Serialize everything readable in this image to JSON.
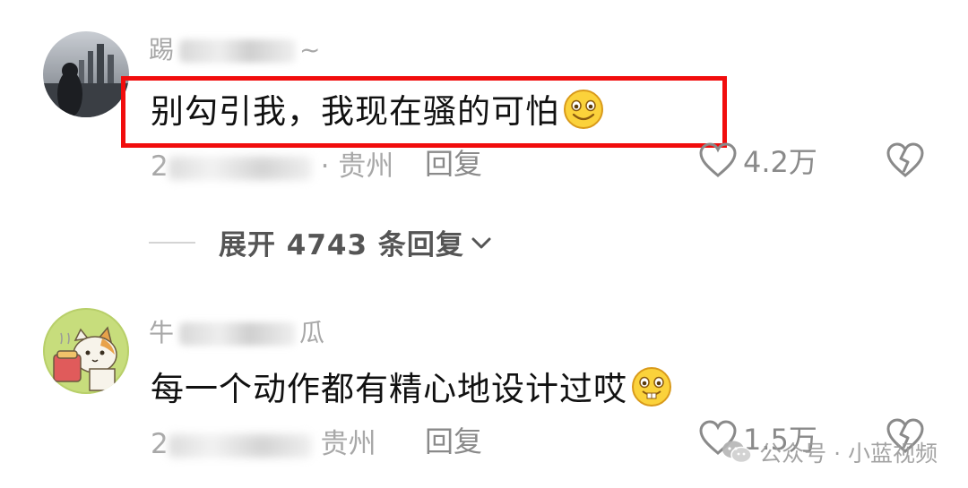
{
  "comments": [
    {
      "username_prefix": "踢",
      "username_suffix": "~",
      "text": "别勾引我，我现在骚的可怕",
      "meta_prefix": "2",
      "location": "· 贵州",
      "reply_label": "回复",
      "like_count": "4.2万",
      "emoji": "smiling-face-emoji",
      "highlighted": true
    },
    {
      "username_prefix": "牛",
      "username_suffix": "瓜",
      "text": "每一个动作都有精心地设计过哎",
      "meta_prefix": "2",
      "location": "贵州",
      "reply_label": "回复",
      "like_count": "1.5万",
      "emoji": "buck-tooth-face-emoji",
      "highlighted": false
    }
  ],
  "expand_replies": {
    "label": "展开 4743 条回复"
  },
  "watermark": {
    "text": "公众号 · 小蓝视频"
  },
  "colors": {
    "highlight_border": "#f10d0d",
    "secondary_text": "#a8a8a8",
    "primary_text": "#111111"
  }
}
